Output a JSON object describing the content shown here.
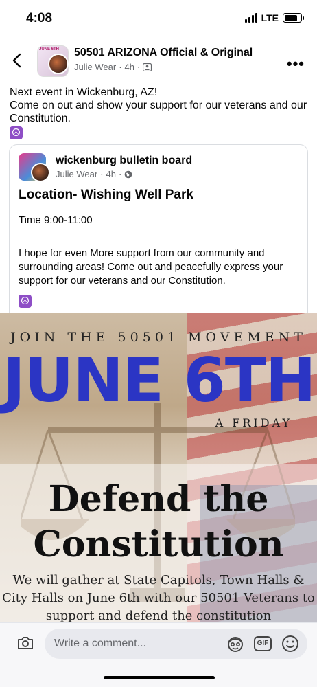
{
  "status_bar": {
    "time": "4:08",
    "network": "LTE"
  },
  "post": {
    "page_name": "50501 ARIZONA Official & Original",
    "author": "Julie Wear",
    "age": "4h",
    "text_line1": "Next event in Wickenburg, AZ!",
    "text_line2": "Come on out and show your support for our veterans and our Constitution.",
    "emoji": "☮"
  },
  "shared_post": {
    "page_name": "wickenburg bulletin board",
    "author": "Julie Wear",
    "age": "4h",
    "location": "Location- Wishing Well Park",
    "time": "Time 9:00-11:00",
    "body": "I hope for even More support from our community and surrounding areas! Come out and peacefully express your support for our veterans and our Constitution.",
    "emoji": "☮"
  },
  "flyer": {
    "join": "JOIN THE 50501 MOVEMENT",
    "date": "JUNE 6TH",
    "day": "A FRIDAY",
    "headline_line1": "Defend the",
    "headline_line2": "Constitution",
    "details": "We will gather at State Capitols, Town Halls & City Halls on June 6th with our 50501 Veterans to support and defend the constitution"
  },
  "comment_bar": {
    "placeholder": "Write a comment...",
    "gif_label": "GIF"
  }
}
